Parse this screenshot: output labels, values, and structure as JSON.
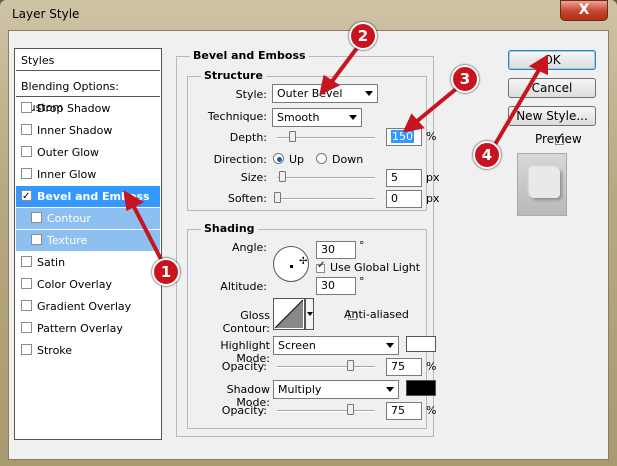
{
  "window": {
    "title": "Layer Style",
    "close_label": "X"
  },
  "styles_list": {
    "header": "Styles",
    "blending": "Blending Options: Custom",
    "items": [
      {
        "label": "Drop Shadow",
        "checked": false
      },
      {
        "label": "Inner Shadow",
        "checked": false
      },
      {
        "label": "Outer Glow",
        "checked": false
      },
      {
        "label": "Inner Glow",
        "checked": false
      },
      {
        "label": "Bevel and Emboss",
        "checked": true,
        "selected": true
      },
      {
        "label": "Contour",
        "checked": false,
        "sub": true
      },
      {
        "label": "Texture",
        "checked": false,
        "sub": true
      },
      {
        "label": "Satin",
        "checked": false
      },
      {
        "label": "Color Overlay",
        "checked": false
      },
      {
        "label": "Gradient Overlay",
        "checked": false
      },
      {
        "label": "Pattern Overlay",
        "checked": false
      },
      {
        "label": "Stroke",
        "checked": false
      }
    ]
  },
  "bevel": {
    "title": "Bevel and Emboss",
    "structure": {
      "title": "Structure",
      "style_label": "Style:",
      "style_value": "Outer Bevel",
      "technique_label": "Technique:",
      "technique_value": "Smooth",
      "depth_label": "Depth:",
      "depth_value": "150",
      "depth_unit": "%",
      "direction_label": "Direction:",
      "dir_up": "Up",
      "dir_down": "Down",
      "direction_selected": "Up",
      "size_label": "Size:",
      "size_value": "5",
      "size_unit": "px",
      "soften_label": "Soften:",
      "soften_value": "0",
      "soften_unit": "px"
    },
    "shading": {
      "title": "Shading",
      "angle_label": "Angle:",
      "angle_value": "30",
      "angle_unit": "°",
      "use_global": "Use Global Light",
      "use_global_checked": true,
      "altitude_label": "Altitude:",
      "altitude_value": "30",
      "altitude_unit": "°",
      "gloss_label": "Gloss Contour:",
      "anti_aliased": "Anti-aliased",
      "anti_aliased_checked": false,
      "highlight_label": "Highlight Mode:",
      "highlight_value": "Screen",
      "highlight_color": "#ffffff",
      "opacity1_label": "Opacity:",
      "opacity1_value": "75",
      "opacity1_unit": "%",
      "shadow_label": "Shadow Mode:",
      "shadow_value": "Multiply",
      "shadow_color": "#000000",
      "opacity2_label": "Opacity:",
      "opacity2_value": "75",
      "opacity2_unit": "%"
    }
  },
  "buttons": {
    "ok": "OK",
    "cancel": "Cancel",
    "new_style": "New Style...",
    "preview": "Preview",
    "preview_checked": true
  },
  "markers": [
    "1",
    "2",
    "3",
    "4"
  ],
  "colors": {
    "selection": "#3399ff",
    "marker": "#c8141e"
  }
}
